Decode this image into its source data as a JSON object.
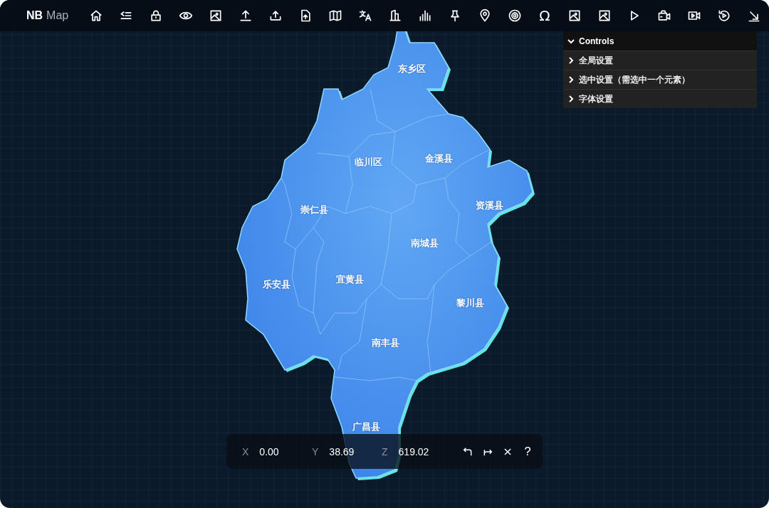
{
  "brand": {
    "bold": "NB",
    "light": "Map"
  },
  "toolbar_glyph": "Ω",
  "controls": {
    "title": "Controls",
    "expanded": true,
    "sections": [
      {
        "label": "全局设置",
        "expanded": false
      },
      {
        "label": "选中设置（需选中一个元素）",
        "expanded": false
      },
      {
        "label": "字体设置",
        "expanded": false
      }
    ]
  },
  "regions": [
    {
      "label": "东乡区"
    },
    {
      "label": "临川区"
    },
    {
      "label": "金溪县"
    },
    {
      "label": "资溪县"
    },
    {
      "label": "崇仁县"
    },
    {
      "label": "南城县"
    },
    {
      "label": "乐安县"
    },
    {
      "label": "宜黄县"
    },
    {
      "label": "黎川县"
    },
    {
      "label": "南丰县"
    },
    {
      "label": "广昌县"
    }
  ],
  "coordinates": [
    {
      "axis": "X",
      "value": "0.00"
    },
    {
      "axis": "Y",
      "value": "38.69"
    },
    {
      "axis": "Z",
      "value": "619.02"
    }
  ],
  "help": "?"
}
